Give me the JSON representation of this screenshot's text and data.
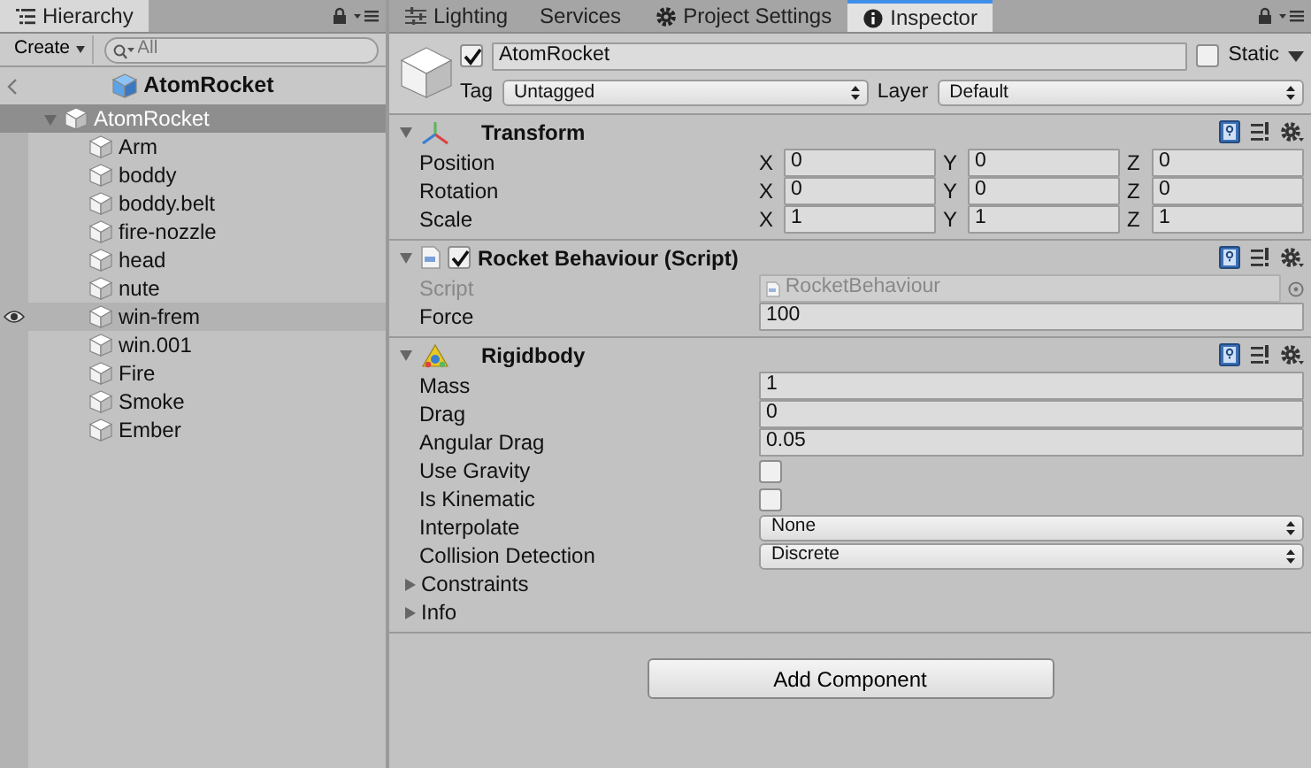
{
  "hierarchy": {
    "tab": {
      "label": "Hierarchy",
      "selected": true
    },
    "create_button": "Create",
    "search": {
      "placeholder": "All"
    },
    "scene_title": "AtomRocket",
    "tree": [
      {
        "label": "AtomRocket",
        "expanded": true,
        "selected": true,
        "highlighted": false,
        "children": [
          {
            "label": "Arm",
            "selected": false,
            "highlighted": false
          },
          {
            "label": "boddy",
            "selected": false,
            "highlighted": false
          },
          {
            "label": "boddy.belt",
            "selected": false,
            "highlighted": false
          },
          {
            "label": "fire-nozzle",
            "selected": false,
            "highlighted": false
          },
          {
            "label": "head",
            "selected": false,
            "highlighted": false
          },
          {
            "label": "nute",
            "selected": false,
            "highlighted": false
          },
          {
            "label": "win-frem",
            "selected": false,
            "highlighted": true
          },
          {
            "label": "win.001",
            "selected": false,
            "highlighted": false
          },
          {
            "label": "Fire",
            "selected": false,
            "highlighted": false
          },
          {
            "label": "Smoke",
            "selected": false,
            "highlighted": false
          },
          {
            "label": "Ember",
            "selected": false,
            "highlighted": false
          }
        ]
      }
    ]
  },
  "inspector_tabs": [
    {
      "label": "Lighting",
      "kind": "lighting",
      "selected": false
    },
    {
      "label": "Services",
      "kind": "plain",
      "selected": false
    },
    {
      "label": "Project Settings",
      "kind": "settings",
      "selected": false
    },
    {
      "label": "Inspector",
      "kind": "info",
      "selected": true
    }
  ],
  "object": {
    "active": true,
    "name": "AtomRocket",
    "static": false,
    "static_label": "Static",
    "tag_label": "Tag",
    "tag": "Untagged",
    "layer_label": "Layer",
    "layer": "Default"
  },
  "components": [
    {
      "kind": "transform",
      "title": "Transform",
      "expanded": true,
      "rows": [
        {
          "kind": "vector",
          "label": "Position",
          "disabled": false,
          "fields": [
            {
              "axis": "X",
              "value": "0"
            },
            {
              "axis": "Y",
              "value": "0"
            },
            {
              "axis": "Z",
              "value": "0"
            }
          ]
        },
        {
          "kind": "vector",
          "label": "Rotation",
          "disabled": false,
          "fields": [
            {
              "axis": "X",
              "value": "0"
            },
            {
              "axis": "Y",
              "value": "0"
            },
            {
              "axis": "Z",
              "value": "0"
            }
          ]
        },
        {
          "kind": "vector",
          "label": "Scale",
          "disabled": false,
          "fields": [
            {
              "axis": "X",
              "value": "1"
            },
            {
              "axis": "Y",
              "value": "1"
            },
            {
              "axis": "Z",
              "value": "1"
            }
          ]
        }
      ]
    },
    {
      "kind": "script",
      "title": "Rocket Behaviour (Script)",
      "expanded": true,
      "enabled": true,
      "rows": [
        {
          "kind": "object",
          "label": "Script",
          "value": "RocketBehaviour",
          "disabled": true
        },
        {
          "kind": "text",
          "label": "Force",
          "value": "100",
          "disabled": false
        }
      ]
    },
    {
      "kind": "rigidbody",
      "title": "Rigidbody",
      "expanded": true,
      "rows": [
        {
          "kind": "text",
          "label": "Mass",
          "value": "1",
          "disabled": false
        },
        {
          "kind": "text",
          "label": "Drag",
          "value": "0",
          "disabled": false
        },
        {
          "kind": "text",
          "label": "Angular Drag",
          "value": "0.05",
          "disabled": false
        },
        {
          "kind": "checkbox",
          "label": "Use Gravity",
          "checked": false,
          "disabled": false
        },
        {
          "kind": "checkbox",
          "label": "Is Kinematic",
          "checked": false,
          "disabled": false
        },
        {
          "kind": "dropdown",
          "label": "Interpolate",
          "value": "None",
          "disabled": false
        },
        {
          "kind": "dropdown",
          "label": "Collision Detection",
          "value": "Discrete",
          "disabled": false
        },
        {
          "kind": "foldout",
          "label": "Constraints",
          "expanded": false,
          "disabled": false
        },
        {
          "kind": "foldout",
          "label": "Info",
          "expanded": false,
          "disabled": false
        }
      ]
    }
  ],
  "add_component": "Add Component"
}
